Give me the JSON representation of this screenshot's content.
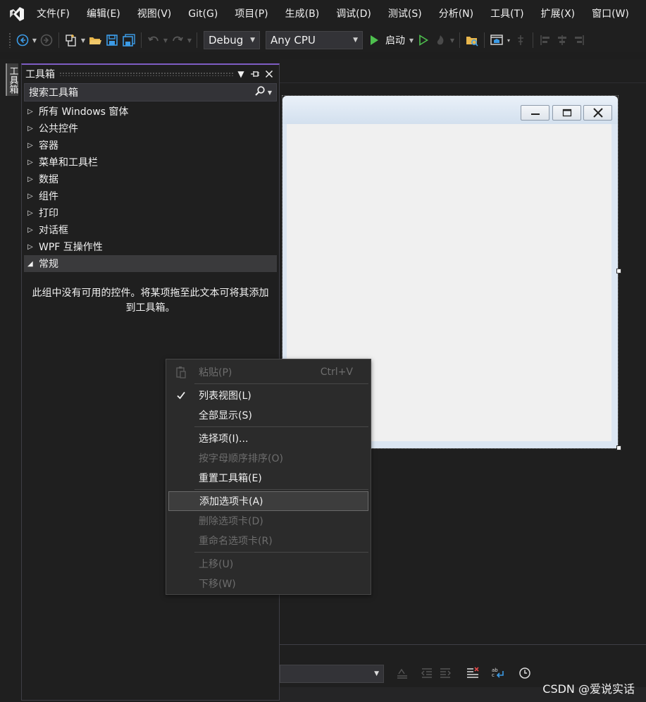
{
  "menu": [
    "文件(F)",
    "编辑(E)",
    "视图(V)",
    "Git(G)",
    "项目(P)",
    "生成(B)",
    "调试(D)",
    "测试(S)",
    "分析(N)",
    "工具(T)",
    "扩展(X)",
    "窗口(W)"
  ],
  "toolbar": {
    "config": "Debug",
    "platform": "Any CPU",
    "start_label": "启动"
  },
  "side_tab": "工具箱",
  "toolbox": {
    "title": "工具箱",
    "search_placeholder": "搜索工具箱",
    "groups": [
      {
        "label": "所有 Windows 窗体",
        "expanded": false
      },
      {
        "label": "公共控件",
        "expanded": false
      },
      {
        "label": "容器",
        "expanded": false
      },
      {
        "label": "菜单和工具栏",
        "expanded": false
      },
      {
        "label": "数据",
        "expanded": false
      },
      {
        "label": "组件",
        "expanded": false
      },
      {
        "label": "打印",
        "expanded": false
      },
      {
        "label": "对话框",
        "expanded": false
      },
      {
        "label": "WPF 互操作性",
        "expanded": false
      },
      {
        "label": "常规",
        "expanded": true
      }
    ],
    "empty_message": "此组中没有可用的控件。将某项拖至此文本可将其添加到工具箱。"
  },
  "context_menu": {
    "paste": "粘贴(P)",
    "paste_shortcut": "Ctrl+V",
    "list_view": "列表视图(L)",
    "show_all": "全部显示(S)",
    "choose_items": "选择项(I)...",
    "sort_alpha": "按字母顺序排序(O)",
    "reset_toolbox": "重置工具箱(E)",
    "add_tab": "添加选项卡(A)",
    "delete_tab": "删除选项卡(D)",
    "rename_tab": "重命名选项卡(R)",
    "move_up": "上移(U)",
    "move_down": "下移(W)"
  },
  "watermark": "CSDN @爱说实话",
  "colors": {
    "accent": "#7e5dc4",
    "start_green": "#4ec04e",
    "save_blue": "#3c9be6",
    "folder_yellow": "#e8b64c"
  }
}
